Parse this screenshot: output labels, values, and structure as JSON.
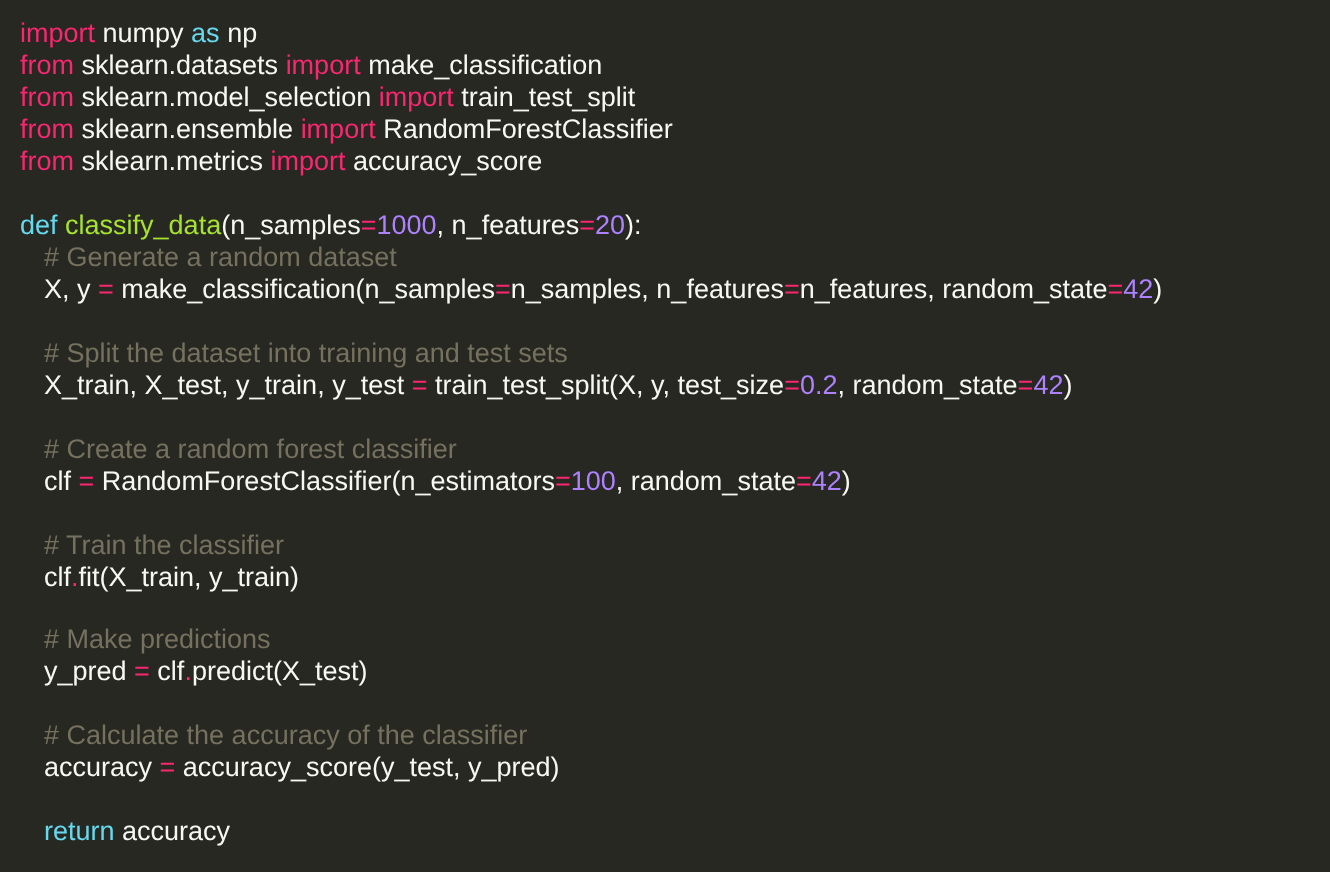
{
  "editor": {
    "blocks": [
      {
        "lines": [
          {
            "tokens": [
              {
                "kind": "keyword",
                "text": "import"
              },
              {
                "kind": "text",
                "text": " numpy "
              },
              {
                "kind": "storage",
                "text": "as"
              },
              {
                "kind": "text",
                "text": " np"
              }
            ]
          },
          {
            "tokens": [
              {
                "kind": "keyword",
                "text": "from"
              },
              {
                "kind": "text",
                "text": " sklearn.datasets "
              },
              {
                "kind": "keyword",
                "text": "import"
              },
              {
                "kind": "text",
                "text": " make_classification"
              }
            ]
          },
          {
            "tokens": [
              {
                "kind": "keyword",
                "text": "from"
              },
              {
                "kind": "text",
                "text": " sklearn.model_selection "
              },
              {
                "kind": "keyword",
                "text": "import"
              },
              {
                "kind": "text",
                "text": " train_test_split"
              }
            ]
          },
          {
            "tokens": [
              {
                "kind": "keyword",
                "text": "from"
              },
              {
                "kind": "text",
                "text": " sklearn.ensemble "
              },
              {
                "kind": "keyword",
                "text": "import"
              },
              {
                "kind": "text",
                "text": " RandomForestClassifier"
              }
            ]
          },
          {
            "tokens": [
              {
                "kind": "keyword",
                "text": "from"
              },
              {
                "kind": "text",
                "text": " sklearn.metrics "
              },
              {
                "kind": "keyword",
                "text": "import"
              },
              {
                "kind": "text",
                "text": " accuracy_score"
              }
            ]
          }
        ]
      },
      {
        "lines": [
          {
            "tokens": [
              {
                "kind": "storage",
                "text": "def "
              },
              {
                "kind": "function",
                "text": "classify_data"
              },
              {
                "kind": "text",
                "text": "(n_samples"
              },
              {
                "kind": "operator",
                "text": "="
              },
              {
                "kind": "number",
                "text": "1000"
              },
              {
                "kind": "text",
                "text": ", n_features"
              },
              {
                "kind": "operator",
                "text": "="
              },
              {
                "kind": "number",
                "text": "20"
              },
              {
                "kind": "text",
                "text": "):"
              }
            ],
            "children": [
              {
                "lines": [
                  {
                    "tokens": [
                      {
                        "kind": "comment",
                        "text": "# Generate a random dataset"
                      }
                    ]
                  },
                  {
                    "tokens": [
                      {
                        "kind": "text",
                        "text": "X, y "
                      },
                      {
                        "kind": "operator",
                        "text": "="
                      },
                      {
                        "kind": "text",
                        "text": " make_classification(n_samples"
                      },
                      {
                        "kind": "operator",
                        "text": "="
                      },
                      {
                        "kind": "text",
                        "text": "n_samples, n_features"
                      },
                      {
                        "kind": "operator",
                        "text": "="
                      },
                      {
                        "kind": "text",
                        "text": "n_features, random_state"
                      },
                      {
                        "kind": "operator",
                        "text": "="
                      },
                      {
                        "kind": "number",
                        "text": "42"
                      },
                      {
                        "kind": "text",
                        "text": ")"
                      }
                    ]
                  }
                ]
              },
              {
                "lines": [
                  {
                    "tokens": [
                      {
                        "kind": "comment",
                        "text": "# Split the dataset into training and test sets"
                      }
                    ]
                  },
                  {
                    "tokens": [
                      {
                        "kind": "text",
                        "text": "X_train, X_test, y_train, y_test "
                      },
                      {
                        "kind": "operator",
                        "text": "="
                      },
                      {
                        "kind": "text",
                        "text": " train_test_split(X, y, test_size"
                      },
                      {
                        "kind": "operator",
                        "text": "="
                      },
                      {
                        "kind": "number",
                        "text": "0.2"
                      },
                      {
                        "kind": "text",
                        "text": ", random_state"
                      },
                      {
                        "kind": "operator",
                        "text": "="
                      },
                      {
                        "kind": "number",
                        "text": "42"
                      },
                      {
                        "kind": "text",
                        "text": ")"
                      }
                    ]
                  }
                ]
              },
              {
                "lines": [
                  {
                    "tokens": [
                      {
                        "kind": "comment",
                        "text": "# Create a random forest classifier"
                      }
                    ]
                  },
                  {
                    "tokens": [
                      {
                        "kind": "text",
                        "text": "clf "
                      },
                      {
                        "kind": "operator",
                        "text": "="
                      },
                      {
                        "kind": "text",
                        "text": " RandomForestClassifier(n_estimators"
                      },
                      {
                        "kind": "operator",
                        "text": "="
                      },
                      {
                        "kind": "number",
                        "text": "100"
                      },
                      {
                        "kind": "text",
                        "text": ", random_state"
                      },
                      {
                        "kind": "operator",
                        "text": "="
                      },
                      {
                        "kind": "number",
                        "text": "42"
                      },
                      {
                        "kind": "text",
                        "text": ")"
                      }
                    ]
                  }
                ]
              },
              {
                "lines": [
                  {
                    "tokens": [
                      {
                        "kind": "comment",
                        "text": "# Train the classifier"
                      }
                    ]
                  },
                  {
                    "tokens": [
                      {
                        "kind": "text",
                        "text": "clf"
                      },
                      {
                        "kind": "operator",
                        "text": "."
                      },
                      {
                        "kind": "text",
                        "text": "fit(X_train, y_train)"
                      }
                    ]
                  }
                ]
              },
              {
                "lines": [
                  {
                    "tokens": [
                      {
                        "kind": "comment",
                        "text": "# Make predictions"
                      }
                    ]
                  },
                  {
                    "tokens": [
                      {
                        "kind": "text",
                        "text": "y_pred "
                      },
                      {
                        "kind": "operator",
                        "text": "="
                      },
                      {
                        "kind": "text",
                        "text": " clf"
                      },
                      {
                        "kind": "operator",
                        "text": "."
                      },
                      {
                        "kind": "text",
                        "text": "predict(X_test)"
                      }
                    ]
                  }
                ]
              },
              {
                "lines": [
                  {
                    "tokens": [
                      {
                        "kind": "comment",
                        "text": "# Calculate the accuracy of the classifier"
                      }
                    ]
                  },
                  {
                    "tokens": [
                      {
                        "kind": "text",
                        "text": "accuracy "
                      },
                      {
                        "kind": "operator",
                        "text": "="
                      },
                      {
                        "kind": "text",
                        "text": " accuracy_score(y_test, y_pred)"
                      }
                    ]
                  }
                ]
              },
              {
                "lines": [
                  {
                    "tokens": [
                      {
                        "kind": "storage",
                        "text": "return"
                      },
                      {
                        "kind": "text",
                        "text": " accuracy"
                      }
                    ]
                  }
                ]
              }
            ]
          }
        ]
      }
    ]
  }
}
